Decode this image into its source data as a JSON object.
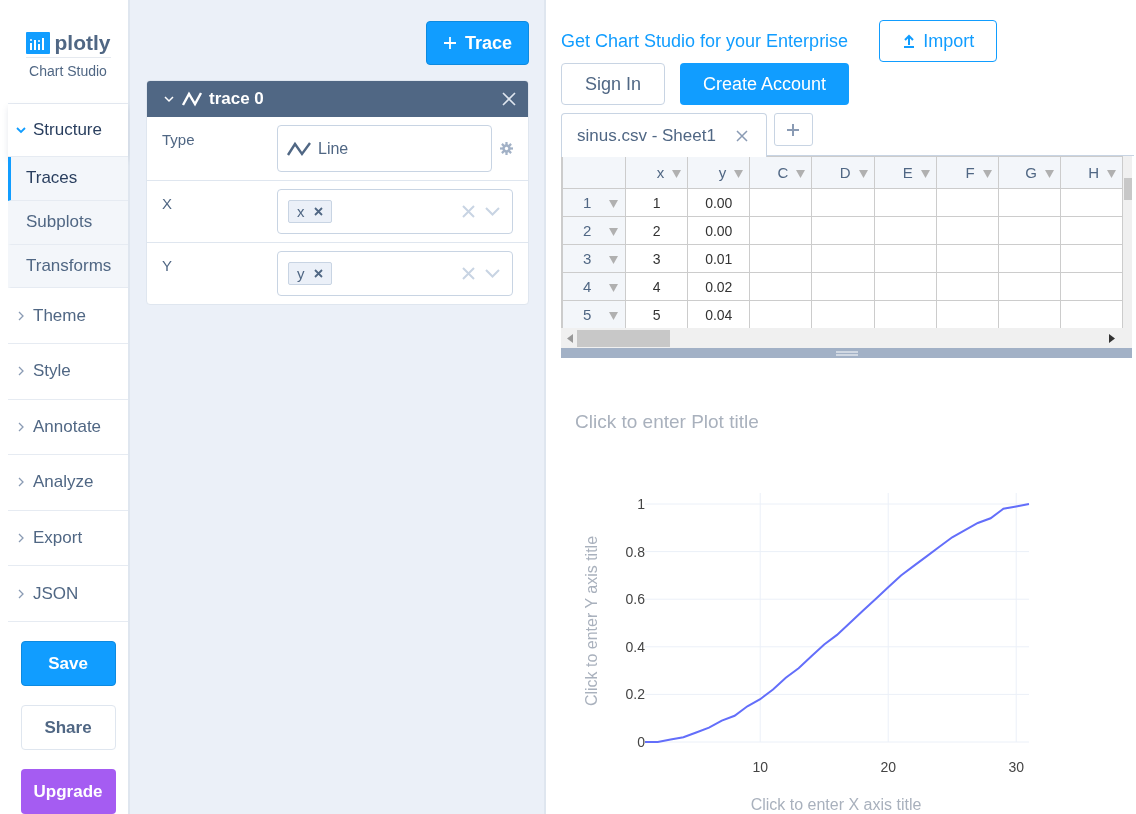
{
  "logo": {
    "wordmark": "plotly",
    "subtitle": "Chart Studio"
  },
  "sidebar": {
    "groups": [
      {
        "label": "Structure",
        "expanded": true,
        "children": [
          {
            "label": "Traces",
            "selected": true
          },
          {
            "label": "Subplots",
            "selected": false
          },
          {
            "label": "Transforms",
            "selected": false
          }
        ]
      },
      {
        "label": "Theme",
        "expanded": false
      },
      {
        "label": "Style",
        "expanded": false
      },
      {
        "label": "Annotate",
        "expanded": false
      },
      {
        "label": "Analyze",
        "expanded": false
      },
      {
        "label": "Export",
        "expanded": false
      },
      {
        "label": "JSON",
        "expanded": false
      }
    ]
  },
  "sidebar_buttons": [
    {
      "label": "Save",
      "kind": "primary"
    },
    {
      "label": "Share",
      "kind": "secondary"
    },
    {
      "label": "Upgrade",
      "kind": "upgrade"
    }
  ],
  "add_trace_button": {
    "label": "Trace"
  },
  "trace_panel": {
    "title": "trace 0",
    "expanded": true,
    "fields": [
      {
        "label": "Type",
        "kind": "type",
        "value": "Line"
      },
      {
        "label": "X",
        "kind": "multiselect",
        "tags": [
          "x"
        ]
      },
      {
        "label": "Y",
        "kind": "multiselect",
        "tags": [
          "y"
        ]
      }
    ]
  },
  "header": {
    "enterprise_link": "Get Chart Studio for your Enterprise",
    "import_button": "Import",
    "sign_in_button": "Sign In",
    "create_account_button": "Create Account"
  },
  "sheet": {
    "tabs": [
      {
        "label": "sinus.csv - Sheet1",
        "selected": true
      }
    ],
    "columns": [
      "x",
      "y",
      "C",
      "D",
      "E",
      "F",
      "G",
      "H"
    ],
    "rows": [
      {
        "index": "1",
        "cells": [
          "1",
          "0.00"
        ]
      },
      {
        "index": "2",
        "cells": [
          "2",
          "0.00"
        ]
      },
      {
        "index": "3",
        "cells": [
          "3",
          "0.01"
        ]
      },
      {
        "index": "4",
        "cells": [
          "4",
          "0.02"
        ]
      },
      {
        "index": "5",
        "cells": [
          "5",
          "0.04"
        ]
      }
    ]
  },
  "plot": {
    "title_placeholder": "Click to enter Plot title",
    "chart_data": {
      "type": "line",
      "xlabel": "Click to enter X axis title",
      "ylabel": "Click to enter Y axis title",
      "x": [
        1,
        2,
        3,
        4,
        5,
        6,
        7,
        8,
        9,
        10,
        11,
        12,
        13,
        14,
        15,
        16,
        17,
        18,
        19,
        20,
        21,
        22,
        23,
        24,
        25,
        26,
        27,
        28,
        29,
        30,
        31
      ],
      "series": [
        {
          "color": "#636efa",
          "values": [
            0.0,
            0.0,
            0.01,
            0.02,
            0.04,
            0.06,
            0.09,
            0.11,
            0.15,
            0.18,
            0.22,
            0.27,
            0.31,
            0.36,
            0.41,
            0.45,
            0.5,
            0.55,
            0.6,
            0.65,
            0.7,
            0.74,
            0.78,
            0.82,
            0.86,
            0.89,
            0.92,
            0.94,
            0.98,
            0.99,
            1.0
          ]
        }
      ],
      "xlim": [
        1,
        31
      ],
      "ylim": [
        0,
        1
      ],
      "grid": true,
      "xticks": [
        10,
        20,
        30
      ],
      "yticks": [
        0,
        0.2,
        0.4,
        0.6,
        0.8,
        1
      ]
    }
  }
}
